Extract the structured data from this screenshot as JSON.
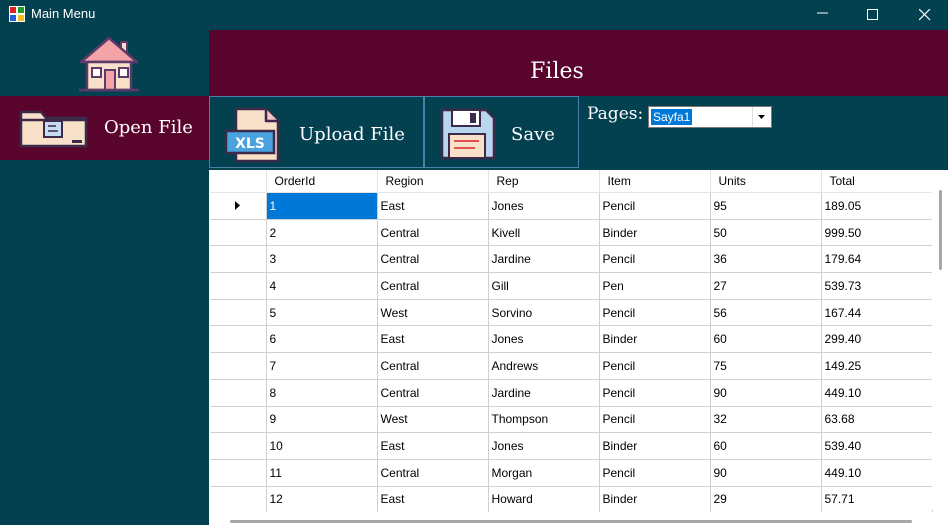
{
  "window": {
    "title": "Main Menu"
  },
  "sidebar": {
    "open_file_label": "Open File"
  },
  "header": {
    "title": "Files"
  },
  "toolbar": {
    "upload_label": "Upload File",
    "upload_icon_text": "XLS",
    "save_label": "Save",
    "pages_label": "Pages:",
    "pages_selected": "Sayfa1"
  },
  "colors": {
    "teal": "#044150",
    "maroon": "#58042d",
    "selection": "#0078d7",
    "button_border": "#4c7fa5"
  },
  "table": {
    "columns": [
      "OrderId",
      "Region",
      "Rep",
      "Item",
      "Units",
      "Total"
    ],
    "rows": [
      [
        "1",
        "East",
        "Jones",
        "Pencil",
        "95",
        "189.05"
      ],
      [
        "2",
        "Central",
        "Kivell",
        "Binder",
        "50",
        "999.50"
      ],
      [
        "3",
        "Central",
        "Jardine",
        "Pencil",
        "36",
        "179.64"
      ],
      [
        "4",
        "Central",
        "Gill",
        "Pen",
        "27",
        "539.73"
      ],
      [
        "5",
        "West",
        "Sorvino",
        "Pencil",
        "56",
        "167.44"
      ],
      [
        "6",
        "East",
        "Jones",
        "Binder",
        "60",
        "299.40"
      ],
      [
        "7",
        "Central",
        "Andrews",
        "Pencil",
        "75",
        "149.25"
      ],
      [
        "8",
        "Central",
        "Jardine",
        "Pencil",
        "90",
        "449.10"
      ],
      [
        "9",
        "West",
        "Thompson",
        "Pencil",
        "32",
        "63.68"
      ],
      [
        "10",
        "East",
        "Jones",
        "Binder",
        "60",
        "539.40"
      ],
      [
        "11",
        "Central",
        "Morgan",
        "Pencil",
        "90",
        "449.10"
      ],
      [
        "12",
        "East",
        "Howard",
        "Binder",
        "29",
        "57.71"
      ]
    ]
  }
}
